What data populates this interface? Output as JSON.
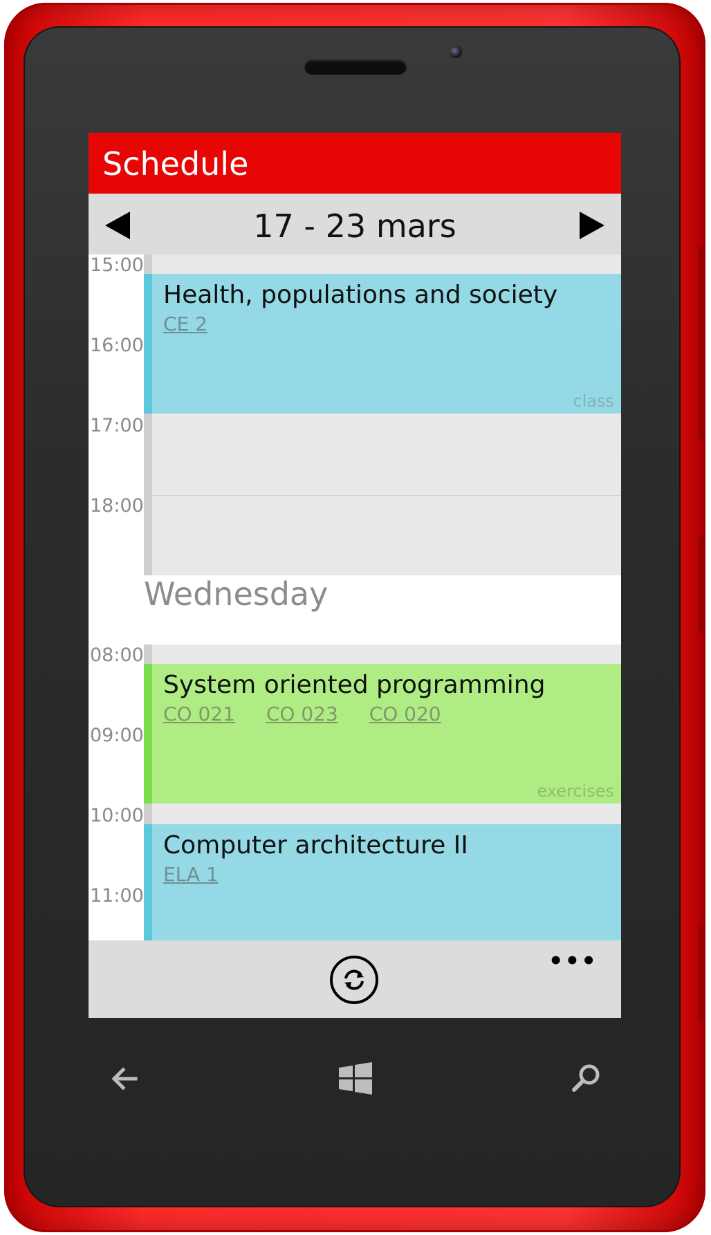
{
  "app": {
    "title": "Schedule"
  },
  "week": {
    "range": "17 - 23 mars"
  },
  "times": {
    "block1": [
      "15:00",
      "16:00",
      "17:00",
      "18:00"
    ],
    "block2": [
      "08:00",
      "09:00",
      "10:00",
      "11:00"
    ]
  },
  "day_heading": "Wednesday",
  "events": [
    {
      "name": "Health, populations and society",
      "rooms": [
        "CE 2"
      ],
      "type": "class",
      "color": "#94d9e5",
      "stripe": "#5cc8dc",
      "room_color": "#6e8f95",
      "type_color": "#83b3bb"
    },
    {
      "name": "System oriented programming",
      "rooms": [
        "CO 021",
        "CO 023",
        "CO 020"
      ],
      "type": "exercises",
      "color": "#b0ec84",
      "stripe": "#7ade4a",
      "room_color": "#7f9a6a",
      "type_color": "#8fbf6c"
    },
    {
      "name": "Computer architecture II",
      "rooms": [
        "ELA 1"
      ],
      "type": "",
      "color": "#94d9e5",
      "stripe": "#5cc8dc",
      "room_color": "#6e8f95",
      "type_color": "#83b3bb"
    }
  ],
  "appbar": {
    "sync_icon": "sync-icon",
    "more_label": "•••"
  },
  "hardware": {
    "back_icon": "back-arrow-icon",
    "start_icon": "windows-logo-icon",
    "search_icon": "search-icon"
  },
  "colors": {
    "accent": "#e60606",
    "phone_body": "#ff2a2a"
  }
}
